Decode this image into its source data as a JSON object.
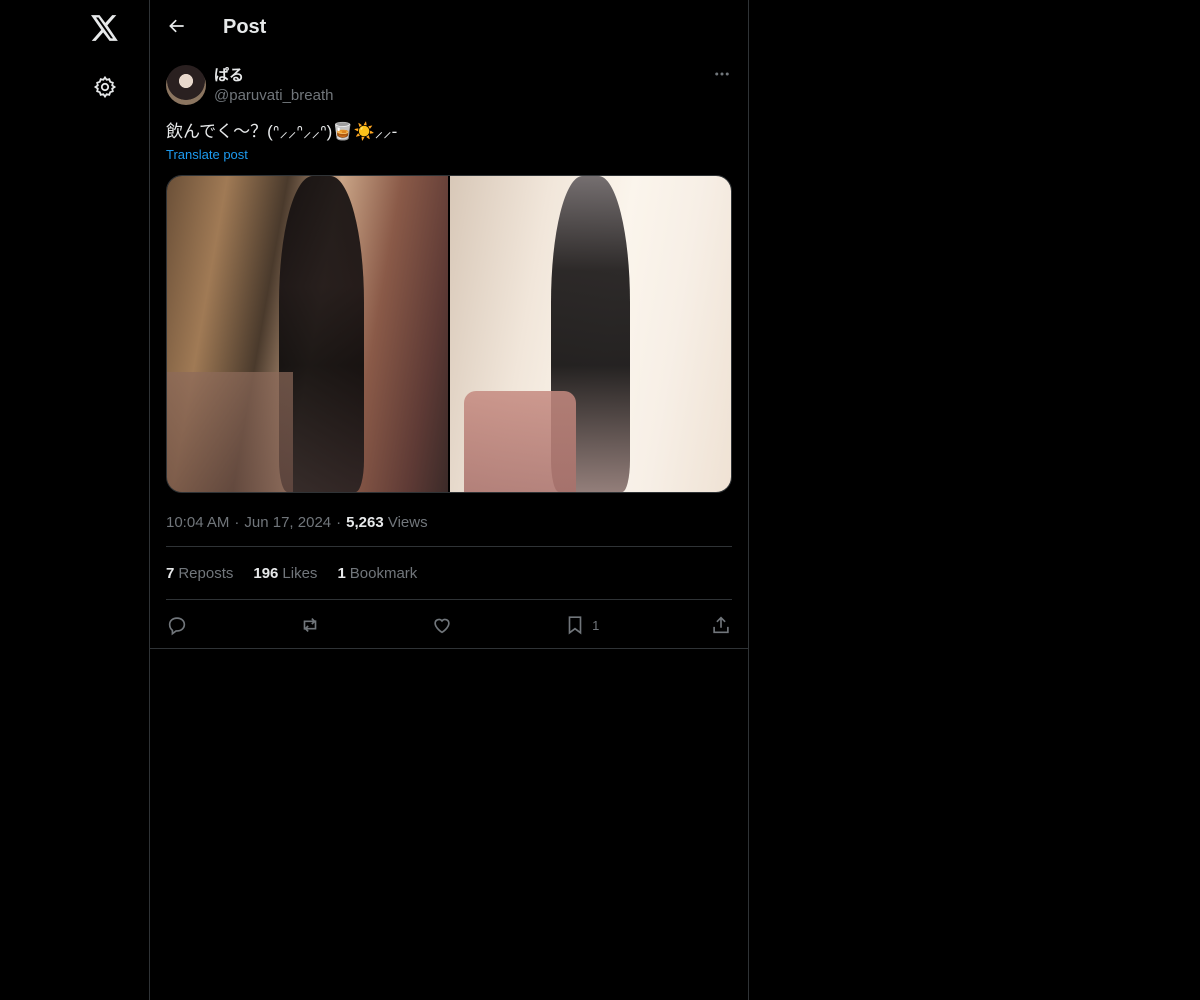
{
  "nav": {
    "logo_icon": "x-logo-icon",
    "settings_icon": "gear-icon"
  },
  "header": {
    "title": "Post"
  },
  "post": {
    "author": {
      "name": "ぱる",
      "handle": "@paruvati_breath"
    },
    "text": "飲んでく〜？(ᐢ⸝⸝ᐢ⸝⸝ᐢ)🥃☀️⸝⸝-",
    "translate_label": "Translate post",
    "media": [
      {
        "description": "photo-1"
      },
      {
        "description": "photo-2"
      }
    ],
    "meta": {
      "time": "10:04 AM",
      "separator": "·",
      "date": "Jun 17, 2024",
      "views_count": "5,263",
      "views_label": "Views"
    },
    "stats": {
      "reposts_count": "7",
      "reposts_label": "Reposts",
      "likes_count": "196",
      "likes_label": "Likes",
      "bookmarks_count": "1",
      "bookmarks_label": "Bookmark"
    },
    "actions": {
      "bookmark_count": "1"
    }
  },
  "colors": {
    "background": "#000000",
    "text_primary": "#e7e9ea",
    "text_secondary": "#71767b",
    "border": "#2f3336",
    "link": "#1d9bf0"
  }
}
